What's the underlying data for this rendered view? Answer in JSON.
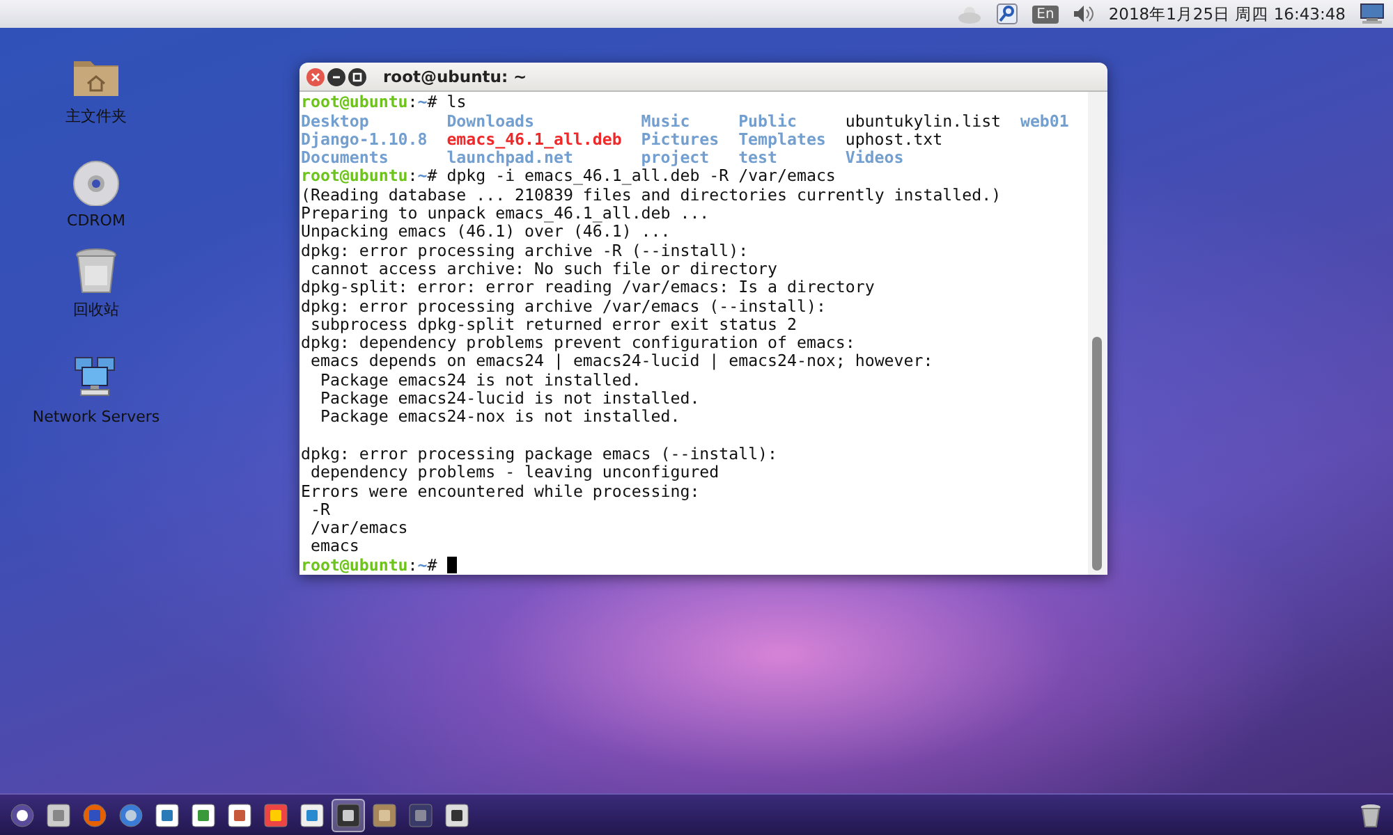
{
  "top_panel": {
    "keyboard_layout": "En",
    "clock": "2018年1月25日 周四 16:43:48"
  },
  "desktop_icons": [
    {
      "label": "主文件夹",
      "kind": "home"
    },
    {
      "label": "CDROM",
      "kind": "disc"
    },
    {
      "label": "回收站",
      "kind": "trash"
    },
    {
      "label": "Network Servers",
      "kind": "network"
    }
  ],
  "terminal": {
    "title": "root@ubuntu: ~",
    "lines": [
      {
        "kind": "prompt",
        "user": "root@ubuntu",
        "separator": ":",
        "path": "~",
        "symbol": "# ",
        "command": "ls",
        "cursor": false
      },
      {
        "kind": "listing",
        "rows": [
          [
            {
              "name": "Desktop",
              "kind": "dir"
            },
            {
              "name": "Downloads",
              "kind": "dir"
            },
            {
              "name": "Music",
              "kind": "dir"
            },
            {
              "name": "Public",
              "kind": "dir"
            },
            {
              "name": "ubuntukylin.list",
              "kind": "file"
            },
            {
              "name": "web01",
              "kind": "dir"
            }
          ],
          [
            {
              "name": "Django-1.10.8",
              "kind": "dir"
            },
            {
              "name": "emacs_46.1_all.deb",
              "kind": "archive"
            },
            {
              "name": "Pictures",
              "kind": "dir"
            },
            {
              "name": "Templates",
              "kind": "dir"
            },
            {
              "name": "uphost.txt",
              "kind": "file"
            }
          ],
          [
            {
              "name": "Documents",
              "kind": "dir"
            },
            {
              "name": "launchpad.net",
              "kind": "dir"
            },
            {
              "name": "project",
              "kind": "dir"
            },
            {
              "name": "test",
              "kind": "dir"
            },
            {
              "name": "Videos",
              "kind": "dir"
            }
          ]
        ]
      },
      {
        "kind": "prompt",
        "user": "root@ubuntu",
        "separator": ":",
        "path": "~",
        "symbol": "# ",
        "command": "dpkg -i emacs_46.1_all.deb -R /var/emacs",
        "cursor": false
      },
      {
        "kind": "output",
        "text": "(Reading database ... 210839 files and directories currently installed.)"
      },
      {
        "kind": "output",
        "text": "Preparing to unpack emacs_46.1_all.deb ..."
      },
      {
        "kind": "output",
        "text": "Unpacking emacs (46.1) over (46.1) ..."
      },
      {
        "kind": "output",
        "text": "dpkg: error processing archive -R (--install):"
      },
      {
        "kind": "output",
        "text": " cannot access archive: No such file or directory"
      },
      {
        "kind": "output",
        "text": "dpkg-split: error: error reading /var/emacs: Is a directory"
      },
      {
        "kind": "output",
        "text": "dpkg: error processing archive /var/emacs (--install):"
      },
      {
        "kind": "output",
        "text": " subprocess dpkg-split returned error exit status 2"
      },
      {
        "kind": "output",
        "text": "dpkg: dependency problems prevent configuration of emacs:"
      },
      {
        "kind": "output",
        "text": " emacs depends on emacs24 | emacs24-lucid | emacs24-nox; however:"
      },
      {
        "kind": "output",
        "text": "  Package emacs24 is not installed."
      },
      {
        "kind": "output",
        "text": "  Package emacs24-lucid is not installed."
      },
      {
        "kind": "output",
        "text": "  Package emacs24-nox is not installed."
      },
      {
        "kind": "blank"
      },
      {
        "kind": "output",
        "text": "dpkg: error processing package emacs (--install):"
      },
      {
        "kind": "output",
        "text": " dependency problems - leaving unconfigured"
      },
      {
        "kind": "output",
        "text": "Errors were encountered while processing:"
      },
      {
        "kind": "output",
        "text": " -R"
      },
      {
        "kind": "output",
        "text": " /var/emacs"
      },
      {
        "kind": "output",
        "text": " emacs"
      },
      {
        "kind": "prompt",
        "user": "root@ubuntu",
        "separator": ":",
        "path": "~",
        "symbol": "# ",
        "cursor": true
      }
    ]
  },
  "taskbar": {
    "launchers": [
      {
        "kind": "start",
        "selected": false
      },
      {
        "kind": "files",
        "selected": false
      },
      {
        "kind": "browser",
        "selected": false
      },
      {
        "kind": "chromium",
        "selected": false
      },
      {
        "kind": "writer",
        "selected": false
      },
      {
        "kind": "calc",
        "selected": false
      },
      {
        "kind": "impress",
        "selected": false
      },
      {
        "kind": "software",
        "selected": false
      },
      {
        "kind": "mail",
        "selected": false
      },
      {
        "kind": "terminal",
        "selected": true
      },
      {
        "kind": "folder",
        "selected": false
      },
      {
        "kind": "workspace",
        "selected": false
      },
      {
        "kind": "disk",
        "selected": false
      }
    ],
    "trash": {
      "kind": "trash"
    }
  }
}
